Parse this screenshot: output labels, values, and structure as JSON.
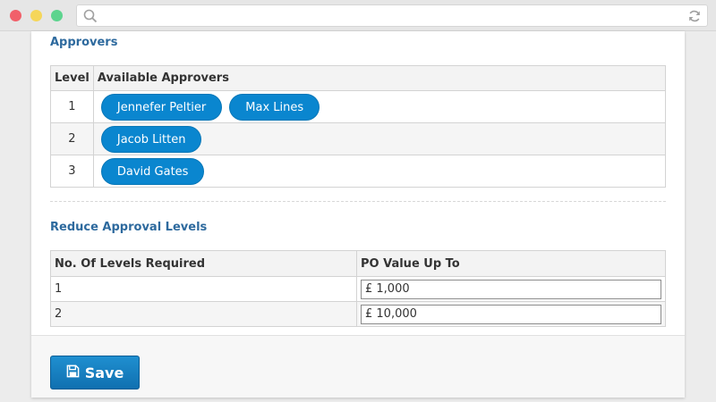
{
  "sections": {
    "approvers_title": "Approvers",
    "reduce_title": "Reduce Approval Levels"
  },
  "approvers_table": {
    "headers": [
      "Level",
      "Available Approvers"
    ],
    "rows": [
      {
        "level": "1",
        "approvers": [
          "Jennefer Peltier",
          "Max Lines"
        ]
      },
      {
        "level": "2",
        "approvers": [
          "Jacob Litten"
        ]
      },
      {
        "level": "3",
        "approvers": [
          "David Gates"
        ]
      }
    ]
  },
  "levels_table": {
    "headers": [
      "No. Of Levels Required",
      "PO Value Up To"
    ],
    "rows": [
      {
        "levels": "1",
        "po_value": "£ 1,000"
      },
      {
        "levels": "2",
        "po_value": "£ 10,000"
      }
    ]
  },
  "footer": {
    "save_label": "Save"
  },
  "colors": {
    "accent": "#0a86cf",
    "title": "#2e6a9e",
    "button": "#1a80c0"
  },
  "icons": [
    "search-icon",
    "reload-icon",
    "save-icon"
  ]
}
